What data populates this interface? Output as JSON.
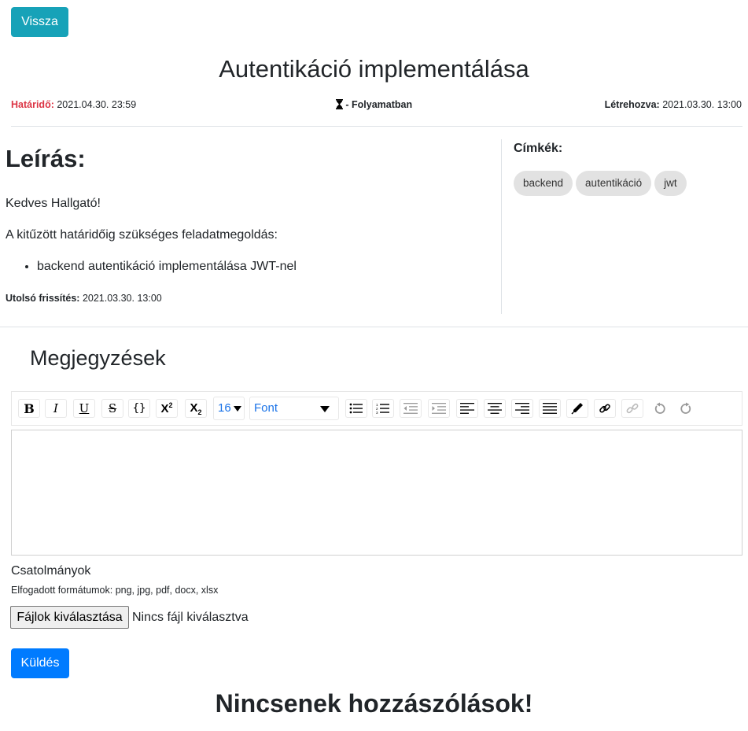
{
  "back_button": "Vissza",
  "title": "Autentikáció implementálása",
  "meta": {
    "deadline_label": "Határidő:",
    "deadline_value": "2021.04.30. 23:59",
    "status": "- Folyamatban",
    "created_label": "Létrehozva:",
    "created_value": "2021.03.30. 13:00"
  },
  "description": {
    "heading": "Leírás:",
    "paragraphs": [
      "Kedves Hallgató!",
      "A kitűzött határidőig szükséges feladatmegoldás:"
    ],
    "bullets": [
      "backend autentikáció implementálása JWT-nel"
    ],
    "updated_label": "Utolsó frissítés:",
    "updated_value": "2021.03.30. 13:00"
  },
  "tags": {
    "heading": "Címkék:",
    "items": [
      "backend",
      "autentikáció",
      "jwt"
    ]
  },
  "notes": {
    "heading": "Megjegyzések",
    "font_size": "16",
    "font": "Font",
    "toolbar_icons": [
      "bold-icon",
      "italic-icon",
      "underline-icon",
      "strikethrough-icon",
      "code-icon",
      "superscript-icon",
      "subscript-icon",
      "unordered-list-icon",
      "ordered-list-icon",
      "outdent-icon",
      "indent-icon",
      "align-left-icon",
      "align-center-icon",
      "align-right-icon",
      "justify-icon",
      "pen-icon",
      "link-icon",
      "unlink-icon",
      "undo-icon",
      "redo-icon"
    ]
  },
  "attachments": {
    "heading": "Csatolmányok",
    "formats": "Elfogadott formátumok: png, jpg, pdf, docx, xlsx",
    "choose_button": "Fájlok kiválasztása",
    "no_file": "Nincs fájl kiválasztva"
  },
  "send_button": "Küldés",
  "no_comments": "Nincsenek hozzászólások!"
}
